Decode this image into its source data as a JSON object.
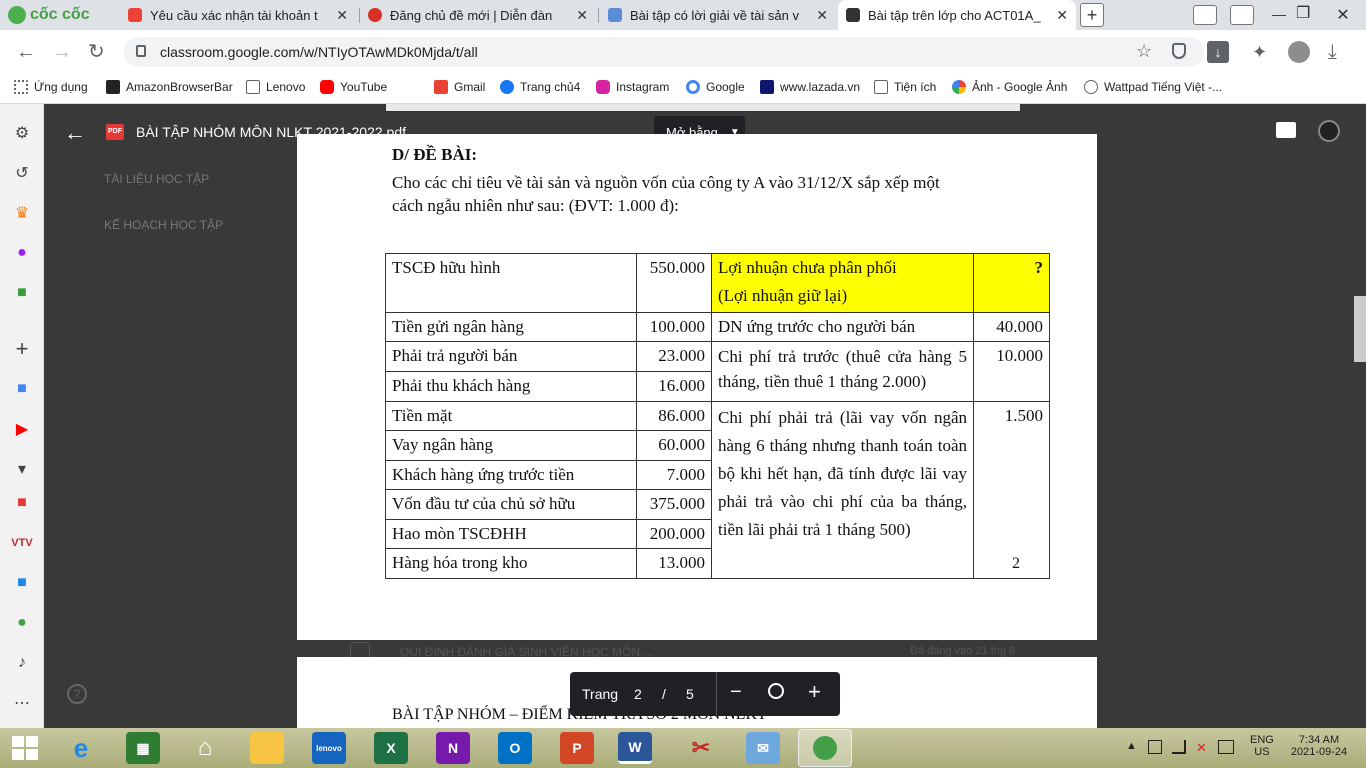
{
  "browser": {
    "brand": "cốc cốc",
    "tabs": [
      {
        "label": "Yêu cầu xác nhận tài khoản t",
        "icon": "gmail-icon",
        "color": "#ea4335"
      },
      {
        "label": "Đăng chủ đề mới | Diễn đàn",
        "icon": "forum-icon",
        "color": "#d93025"
      },
      {
        "label": "Bài tập có lời giải về tài sản v",
        "icon": "image-icon",
        "color": "#5b8dd6"
      },
      {
        "label": "Bài tập trên lớp cho ACT01A_",
        "icon": "classroom-icon",
        "color": "#333333"
      }
    ],
    "url": "classroom.google.com/w/NTIyOTAwMDk0Mjda/t/all",
    "bookmarks": [
      "Ứng dụng",
      "AmazonBrowserBar",
      "Lenovo",
      "YouTube",
      "Gmail",
      "Trang chủ4",
      "Instagram",
      "Google",
      "www.lazada.vn",
      "Tiện ích",
      "Ảnh - Google Ảnh",
      "Wattpad Tiếng Việt -..."
    ]
  },
  "viewer": {
    "file_title": "BÀI TẬP NHÓM MÔN NLKT 2021-2022.pdf",
    "open_with": "Mở bằng",
    "page_label": "Trang",
    "page_current": "2",
    "page_sep": "/",
    "page_total": "5"
  },
  "background_page": {
    "menu1": "TÀI LIỆU HỌC TẬP",
    "menu2": "KẾ HOẠCH HỌC TẬP",
    "row_title": "QUI ĐỊNH ĐÁNH GIÁ SINH VIÊN HỌC MÔN ...",
    "row_meta": "Đã đăng vào 21 thg 8"
  },
  "doc": {
    "heading": "D/ ĐỀ BÀI:",
    "intro1": "Cho các chỉ tiêu về tài sản và nguồn vốn của công ty A vào 31/12/X sắp xếp một",
    "intro2": "cách ngẫu nhiên như sau: (ĐVT: 1.000 đ):",
    "left_rows": [
      {
        "name": "TSCĐ hữu hình",
        "value": "550.000"
      },
      {
        "name": "Tiền gửi ngân hàng",
        "value": "100.000"
      },
      {
        "name": "Phải trả người bán",
        "value": "23.000"
      },
      {
        "name": "Phải thu khách hàng",
        "value": "16.000"
      },
      {
        "name": "Tiền mặt",
        "value": "86.000"
      },
      {
        "name": "Vay ngân hàng",
        "value": "60.000"
      },
      {
        "name": "Khách hàng ứng trước tiền",
        "value": "7.000"
      },
      {
        "name": "Vốn đầu tư của chủ sở hữu",
        "value": "375.000"
      },
      {
        "name": "Hao mòn TSCĐHH",
        "value": "200.000"
      },
      {
        "name": "Hàng hóa trong kho",
        "value": "13.000"
      }
    ],
    "right_rows": [
      {
        "name_l1": "Lợi nhuận chưa phân phối",
        "name_l2": "(Lợi nhuận giữ lại)",
        "value": "?"
      },
      {
        "name": "DN ứng trước cho người bán",
        "value": "40.000"
      },
      {
        "name": "Chi phí trả trước (thuê cửa hàng 5 tháng, tiền thuê 1 tháng 2.000)",
        "value": "10.000"
      },
      {
        "name": "Chi phí phải trả (lãi vay vốn ngân hàng 6 tháng nhưng thanh toán toàn bộ khi hết hạn, đã tính được lãi vay phải trả vào chi phí của ba tháng, tiền lãi phải trả 1 tháng 500)",
        "value": "1.500"
      }
    ],
    "page_number": "2",
    "next_page_header": "BÀI TẬP NHÓM – ĐIỂM KIỂM TRA SỐ 2 MÔN NLKT"
  },
  "taskbar": {
    "lang1": "ENG",
    "lang2": "US",
    "time": "7:34 AM",
    "date": "2021-09-24"
  },
  "colors": {
    "highlight": "#ffff00",
    "viewer_bg": "#393939",
    "taskbar": "#b4b583"
  }
}
